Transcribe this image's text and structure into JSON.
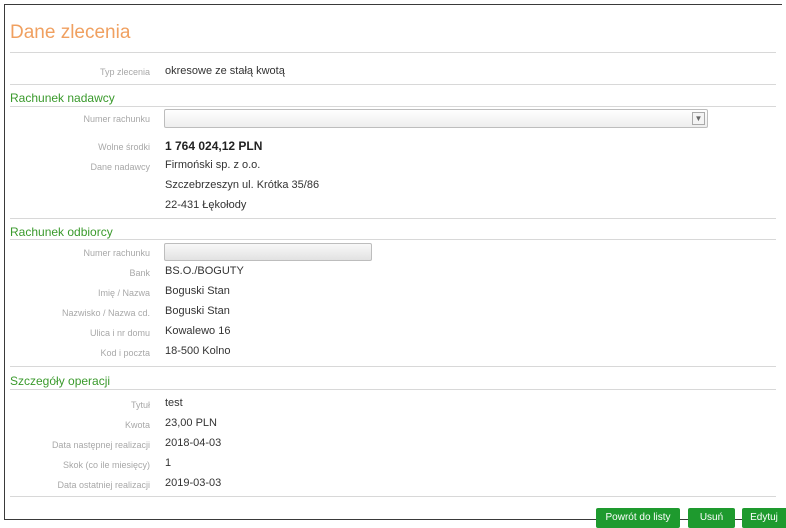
{
  "title": "Dane zlecenia",
  "order_type": {
    "label": "Typ zlecenia",
    "value": "okresowe ze stałą kwotą"
  },
  "sender": {
    "section": "Rachunek nadawcy",
    "account_label": "Numer rachunku",
    "account_value": "",
    "funds_label": "Wolne środki",
    "funds_value": "1 764 024,12 PLN",
    "sender_label": "Dane nadawcy",
    "sender_name": "Firmoński sp. z o.o.",
    "sender_street": "Szczebrzeszyn ul. Krótka 35/86",
    "sender_city": "22-431 Łękołody"
  },
  "recipient": {
    "section": "Rachunek odbiorcy",
    "account_label": "Numer rachunku",
    "account_value": "",
    "bank_label": "Bank",
    "bank_value": "BS.O./BOGUTY",
    "name_label": "Imię / Nazwa",
    "name_value": "Boguski Stan",
    "surname_label": "Nazwisko / Nazwa cd.",
    "surname_value": "Boguski Stan",
    "street_label": "Ulica i nr domu",
    "street_value": "Kowalewo 16",
    "postal_label": "Kod i poczta",
    "postal_value": "18-500 Kolno"
  },
  "details": {
    "section": "Szczegóły operacji",
    "title_label": "Tytuł",
    "title_value": "test",
    "amount_label": "Kwota",
    "amount_value": "23,00 PLN",
    "next_label": "Data następnej realizacji",
    "next_value": "2018-04-03",
    "step_label": "Skok (co ile miesięcy)",
    "step_value": "1",
    "last_label": "Data ostatniej realizacji",
    "last_value": "2019-03-03"
  },
  "buttons": {
    "back": "Powrót do listy",
    "delete": "Usuń",
    "edit": "Edytuj"
  },
  "colors": {
    "title": "#f0a060",
    "section": "#3a9a2c",
    "button": "#1e9a2e"
  }
}
